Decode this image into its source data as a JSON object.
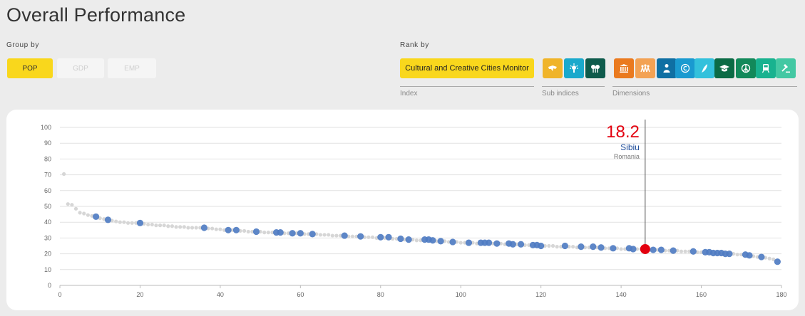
{
  "page_title": "Overall Performance",
  "group_by": {
    "label": "Group by",
    "buttons": [
      {
        "label": "POP",
        "active": true
      },
      {
        "label": "GDP",
        "active": false
      },
      {
        "label": "EMP",
        "active": false
      }
    ]
  },
  "rank_by": {
    "label": "Rank by",
    "index_button": "Cultural and Creative Cities Monitor",
    "index_label": "Index",
    "sub_indices_label": "Sub indices",
    "dimensions_label": "Dimensions",
    "sub_indices": [
      {
        "icon": "cultural-vibrancy-icon",
        "color": "#f0b429"
      },
      {
        "icon": "creative-economy-icon",
        "color": "#1aa9cc"
      },
      {
        "icon": "enabling-environment-icon",
        "color": "#0e5b4c"
      }
    ],
    "dimensions": [
      {
        "icon": "cultural-venues-icon",
        "color": "#ea7a1f"
      },
      {
        "icon": "cultural-participation-icon",
        "color": "#f3a254"
      },
      {
        "icon": "creative-jobs-icon",
        "color": "#0f6fa3"
      },
      {
        "icon": "intellectual-property-icon",
        "color": "#1a9ad0"
      },
      {
        "icon": "new-jobs-icon",
        "color": "#33c1dc"
      },
      {
        "icon": "human-capital-icon",
        "color": "#0b6b45"
      },
      {
        "icon": "openness-tolerance-icon",
        "color": "#12895a"
      },
      {
        "icon": "connectivity-icon",
        "color": "#18b28f"
      },
      {
        "icon": "governance-icon",
        "color": "#43c8a3"
      }
    ]
  },
  "highlight": {
    "value": "18.2",
    "city": "Sibiu",
    "country": "Romania",
    "rank": 146,
    "score": 23
  },
  "chart_data": {
    "type": "scatter",
    "xlim": [
      0,
      180
    ],
    "ylim": [
      0,
      100
    ],
    "x_ticks": [
      0,
      20,
      40,
      60,
      80,
      100,
      120,
      140,
      160,
      180
    ],
    "y_ticks": [
      0,
      10,
      20,
      30,
      40,
      50,
      60,
      70,
      80,
      90,
      100
    ],
    "series": [
      {
        "values": [
          [
            9,
            43.5
          ],
          [
            12,
            41.5
          ],
          [
            20,
            39.5
          ],
          [
            36,
            36.5
          ],
          [
            42,
            35
          ],
          [
            44,
            35
          ],
          [
            49,
            34
          ],
          [
            54,
            33.5
          ],
          [
            55,
            33.5
          ],
          [
            58,
            33
          ],
          [
            60,
            33
          ],
          [
            63,
            32.5
          ],
          [
            71,
            31.5
          ],
          [
            75,
            31
          ],
          [
            80,
            30.5
          ],
          [
            82,
            30.5
          ],
          [
            85,
            29.5
          ],
          [
            87,
            29
          ],
          [
            91,
            29
          ],
          [
            92,
            29
          ],
          [
            93,
            28.5
          ],
          [
            95,
            28
          ],
          [
            98,
            27.5
          ],
          [
            102,
            27
          ],
          [
            105,
            27
          ],
          [
            106,
            27
          ],
          [
            107,
            27
          ],
          [
            109,
            26.5
          ],
          [
            112,
            26.5
          ],
          [
            113,
            26
          ],
          [
            115,
            26
          ],
          [
            118,
            25.5
          ],
          [
            119,
            25.5
          ],
          [
            120,
            25
          ],
          [
            126,
            25
          ],
          [
            130,
            24.5
          ],
          [
            133,
            24.5
          ],
          [
            135,
            24
          ],
          [
            138,
            23.5
          ],
          [
            142,
            23.5
          ],
          [
            143,
            23
          ],
          [
            148,
            22.5
          ],
          [
            150,
            22.5
          ],
          [
            153,
            22
          ],
          [
            158,
            21.5
          ],
          [
            161,
            21
          ],
          [
            162,
            21
          ],
          [
            163,
            20.5
          ],
          [
            164,
            20.5
          ],
          [
            165,
            20.5
          ],
          [
            166,
            20
          ],
          [
            167,
            20
          ],
          [
            171,
            19.5
          ],
          [
            172,
            19
          ],
          [
            175,
            18
          ],
          [
            179,
            15
          ]
        ]
      }
    ],
    "background_series": [
      [
        1,
        70.5
      ],
      [
        2,
        51.5
      ],
      [
        3,
        51
      ],
      [
        4,
        48.5
      ],
      [
        5,
        46
      ],
      [
        6,
        45.5
      ],
      [
        7,
        44.5
      ],
      [
        8,
        44
      ],
      [
        10,
        42.5
      ],
      [
        11,
        42
      ],
      [
        13,
        41
      ],
      [
        14,
        40.5
      ],
      [
        15,
        40
      ],
      [
        16,
        40
      ],
      [
        17,
        39.5
      ],
      [
        18,
        39.5
      ],
      [
        19,
        39.5
      ],
      [
        21,
        39
      ],
      [
        22,
        38.5
      ],
      [
        23,
        38.5
      ],
      [
        24,
        38
      ],
      [
        25,
        38
      ],
      [
        26,
        38
      ],
      [
        27,
        37.5
      ],
      [
        28,
        37.5
      ],
      [
        29,
        37
      ],
      [
        30,
        37
      ],
      [
        31,
        37
      ],
      [
        32,
        36.5
      ],
      [
        33,
        36.5
      ],
      [
        34,
        36.5
      ],
      [
        35,
        36.5
      ],
      [
        37,
        36
      ],
      [
        38,
        36
      ],
      [
        39,
        35.5
      ],
      [
        40,
        35.5
      ],
      [
        41,
        35
      ],
      [
        43,
        35
      ],
      [
        45,
        34.5
      ],
      [
        46,
        34.5
      ],
      [
        47,
        34
      ],
      [
        48,
        34
      ],
      [
        50,
        34
      ],
      [
        51,
        33.5
      ],
      [
        52,
        33.5
      ],
      [
        53,
        33.5
      ],
      [
        56,
        33
      ],
      [
        57,
        33
      ],
      [
        59,
        33
      ],
      [
        61,
        32.5
      ],
      [
        62,
        32.5
      ],
      [
        64,
        32.5
      ],
      [
        65,
        32
      ],
      [
        66,
        32
      ],
      [
        67,
        32
      ],
      [
        68,
        31.5
      ],
      [
        69,
        31.5
      ],
      [
        70,
        31.5
      ],
      [
        72,
        31
      ],
      [
        73,
        31
      ],
      [
        74,
        31
      ],
      [
        76,
        30.5
      ],
      [
        77,
        30.5
      ],
      [
        78,
        30.5
      ],
      [
        79,
        30
      ],
      [
        81,
        30
      ],
      [
        83,
        29.5
      ],
      [
        84,
        29.5
      ],
      [
        86,
        29
      ],
      [
        88,
        29
      ],
      [
        89,
        28.5
      ],
      [
        90,
        28.5
      ],
      [
        94,
        28
      ],
      [
        96,
        28
      ],
      [
        97,
        27.5
      ],
      [
        99,
        27.5
      ],
      [
        100,
        27
      ],
      [
        101,
        27
      ],
      [
        103,
        27
      ],
      [
        104,
        26.5
      ],
      [
        108,
        26.5
      ],
      [
        110,
        26.5
      ],
      [
        111,
        26
      ],
      [
        114,
        26
      ],
      [
        116,
        25.5
      ],
      [
        117,
        25.5
      ],
      [
        121,
        25
      ],
      [
        122,
        25
      ],
      [
        123,
        25
      ],
      [
        124,
        24.5
      ],
      [
        125,
        24.5
      ],
      [
        127,
        24.5
      ],
      [
        128,
        24.5
      ],
      [
        129,
        24
      ],
      [
        131,
        24
      ],
      [
        132,
        24
      ],
      [
        134,
        24
      ],
      [
        136,
        23.5
      ],
      [
        137,
        23.5
      ],
      [
        139,
        23.5
      ],
      [
        140,
        23
      ],
      [
        141,
        23
      ],
      [
        144,
        23
      ],
      [
        145,
        23
      ],
      [
        147,
        22.5
      ],
      [
        149,
        22.5
      ],
      [
        151,
        22
      ],
      [
        152,
        22
      ],
      [
        154,
        22
      ],
      [
        155,
        21.5
      ],
      [
        156,
        21.5
      ],
      [
        157,
        21.5
      ],
      [
        159,
        21
      ],
      [
        160,
        21
      ],
      [
        168,
        20
      ],
      [
        169,
        19.5
      ],
      [
        170,
        19.5
      ],
      [
        173,
        18.5
      ],
      [
        174,
        18
      ],
      [
        176,
        17.5
      ],
      [
        177,
        17
      ],
      [
        178,
        16.5
      ]
    ]
  }
}
